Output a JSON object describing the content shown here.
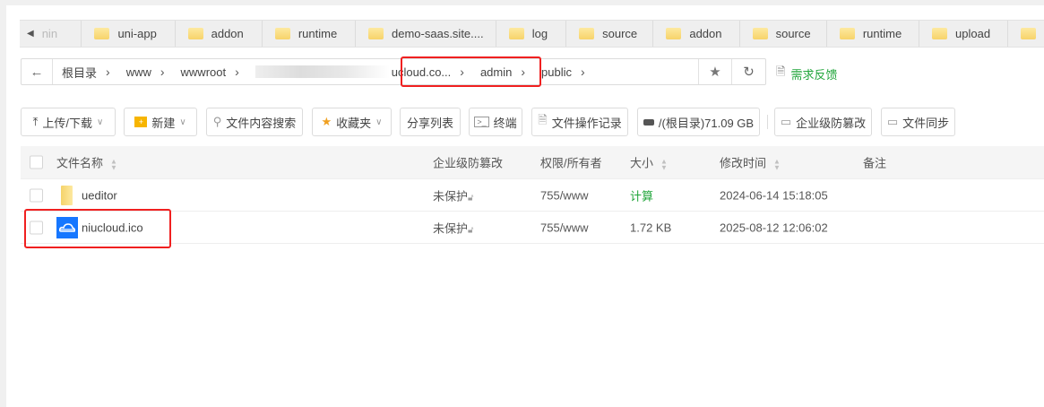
{
  "tabs": [
    {
      "label": "nin",
      "partial": true
    },
    {
      "label": "uni-app"
    },
    {
      "label": "addon"
    },
    {
      "label": "runtime"
    },
    {
      "label": "demo-saas.site...."
    },
    {
      "label": "log"
    },
    {
      "label": "source"
    },
    {
      "label": "addon"
    },
    {
      "label": "source"
    },
    {
      "label": "runtime"
    },
    {
      "label": "upload"
    },
    {
      "label": ""
    }
  ],
  "breadcrumb": {
    "segments": [
      "根目录",
      "www",
      "wwwroot",
      "ucloud.co...",
      "admin",
      "public"
    ]
  },
  "feedback": "需求反馈",
  "toolbar": {
    "upload": "上传/下载",
    "new": "新建",
    "search": "文件内容搜索",
    "favorites": "收藏夹",
    "share": "分享列表",
    "terminal": "终端",
    "log": "文件操作记录",
    "disk": "/(根目录)71.09 GB",
    "tamper": "企业级防篡改",
    "sync": "文件同步"
  },
  "table": {
    "headers": {
      "name": "文件名称",
      "tamper": "企业级防篡改",
      "perm": "权限/所有者",
      "size": "大小",
      "mtime": "修改时间",
      "note": "备注"
    },
    "rows": [
      {
        "name": "ueditor",
        "type": "folder",
        "tamper": "未保护",
        "perm": "755/www",
        "size": "计算",
        "mtime": "2024-06-14 15:18:05",
        "note": ""
      },
      {
        "name": "niucloud.ico",
        "type": "ico",
        "tamper": "未保护",
        "perm": "755/www",
        "size": "1.72 KB",
        "mtime": "2025-08-12 12:06:02",
        "note": ""
      }
    ]
  },
  "colors": {
    "green": "#20a53a",
    "highlight": "#f02020",
    "ico": "#1677ff"
  }
}
